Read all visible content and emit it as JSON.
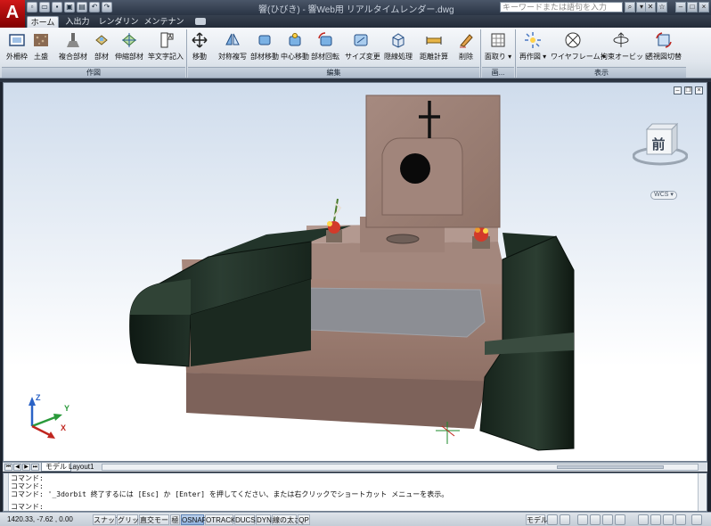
{
  "window": {
    "app_logo": "A",
    "title": "響(ひびき) - 響Web用 リアルタイムレンダー.dwg",
    "search_placeholder": "キーワードまたは語句を入力"
  },
  "tabs": [
    {
      "label": "ホーム",
      "active": true
    },
    {
      "label": "入出力",
      "active": false
    },
    {
      "label": "レンダリング",
      "active": false
    },
    {
      "label": "メンテナンス",
      "active": false
    }
  ],
  "ribbon": {
    "groups": [
      {
        "title": "作図",
        "buttons": [
          "外柵枠",
          "土盛",
          "複合部材",
          "部材",
          "伸縮部材",
          "竿文字記入"
        ]
      },
      {
        "title": "編集",
        "buttons": [
          "移動",
          "対称複写",
          "部材移動",
          "中心移動",
          "部材回転",
          "サイズ変更",
          "隠線処理",
          "距離計算",
          "削除"
        ]
      },
      {
        "title": "画...",
        "buttons": [
          "面取り ▾"
        ]
      },
      {
        "title": "表示",
        "buttons": [
          "再作図 ▾",
          "ワイヤフレーム ▾",
          "拘束オービット",
          "透視図切替"
        ]
      }
    ]
  },
  "viewport": {
    "viewcube_face": "前",
    "wcs_label": "WCS ▾",
    "axes": {
      "x": "X",
      "y": "Y",
      "z": "Z"
    }
  },
  "layout_tabs": [
    {
      "label": "モデル",
      "active": true
    },
    {
      "label": "Layout1",
      "active": false
    }
  ],
  "command_history": [
    "コマンド:",
    "コマンド:",
    "コマンド: '_3dorbit 終了するには [Esc] か [Enter] を押してください、または右クリックでショートカット メニューを表示。"
  ],
  "command_prompt": "コマンド:",
  "status": {
    "coordinates": "1420.33, -7.62 , 0.00",
    "toggles": [
      {
        "label": "スナップ",
        "on": false
      },
      {
        "label": "グリッド",
        "on": false
      },
      {
        "label": "直交モード",
        "on": false
      },
      {
        "label": "極",
        "on": false
      },
      {
        "label": "OSNAP",
        "on": true
      },
      {
        "label": "OTRACK",
        "on": false
      },
      {
        "label": "DUCS",
        "on": false
      },
      {
        "label": "DYN",
        "on": false
      },
      {
        "label": "線の太さ",
        "on": false
      },
      {
        "label": "QP",
        "on": false
      }
    ],
    "model_label": "モデル"
  },
  "colors": {
    "granite": "#9b8178",
    "black_stone": "#1c2a22",
    "viewport_sky": "#cfdcec"
  }
}
